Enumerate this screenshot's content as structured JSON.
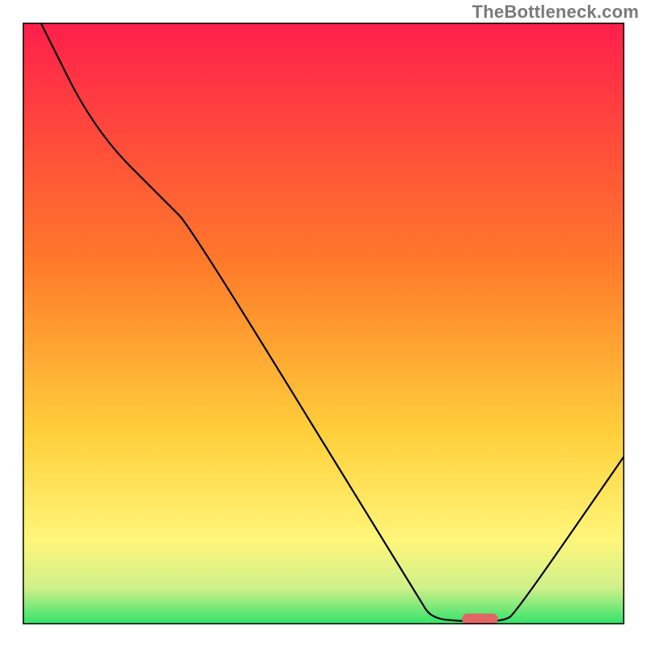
{
  "watermark": "TheBottleneck.com",
  "chart_data": {
    "type": "line",
    "title": "",
    "xlabel": "",
    "ylabel": "",
    "xlim": [
      0,
      100
    ],
    "ylim": [
      0,
      100
    ],
    "grid": false,
    "legend": false,
    "curve": {
      "name": "bottleneck-curve",
      "points": [
        {
          "x": 3,
          "y": 100
        },
        {
          "x": 12,
          "y": 82
        },
        {
          "x": 24,
          "y": 70
        },
        {
          "x": 28,
          "y": 66
        },
        {
          "x": 66,
          "y": 4
        },
        {
          "x": 68,
          "y": 1
        },
        {
          "x": 73,
          "y": 0.5
        },
        {
          "x": 80,
          "y": 0.5
        },
        {
          "x": 82,
          "y": 2
        },
        {
          "x": 100,
          "y": 28
        }
      ]
    },
    "marker": {
      "name": "optimal-marker",
      "x_center": 76,
      "y": 0.9,
      "width": 6,
      "height": 1.8,
      "color": "#e06666"
    },
    "gradient_stops": [
      {
        "offset": 0,
        "color": "#ff1f4b"
      },
      {
        "offset": 40,
        "color": "#ff7a2a"
      },
      {
        "offset": 68,
        "color": "#ffcf3a"
      },
      {
        "offset": 86,
        "color": "#fff67a"
      },
      {
        "offset": 94,
        "color": "#cff08a"
      },
      {
        "offset": 100,
        "color": "#2fe36a"
      }
    ],
    "border_color": "#000000"
  }
}
